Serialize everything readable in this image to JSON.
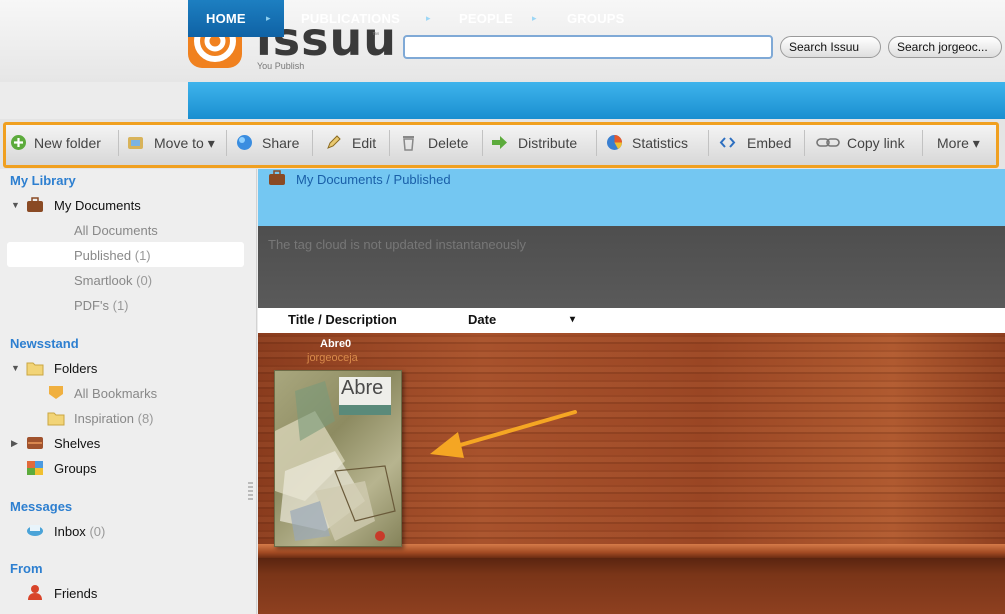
{
  "header": {
    "logo_text": "issuu",
    "logo_tm": "™",
    "tagline": "You Publish",
    "search_value": "",
    "search_issuu_label": "Search Issuu",
    "search_user_label": "Search jorgeoc..."
  },
  "nav": {
    "tabs": [
      {
        "label": "HOME",
        "active": true
      },
      {
        "label": "PUBLICATIONS",
        "active": false
      },
      {
        "label": "PEOPLE",
        "active": false
      },
      {
        "label": "GROUPS",
        "active": false
      }
    ],
    "arrow_glyph": "▸"
  },
  "toolbar": {
    "items": [
      {
        "label": "New folder",
        "icon": "new-folder-icon"
      },
      {
        "label": "Move to ▾",
        "icon": "move-to-icon"
      },
      {
        "label": "Share",
        "icon": "share-icon"
      },
      {
        "label": "Edit",
        "icon": "edit-icon"
      },
      {
        "label": "Delete",
        "icon": "delete-icon"
      },
      {
        "label": "Distribute",
        "icon": "distribute-icon"
      },
      {
        "label": "Statistics",
        "icon": "statistics-icon"
      },
      {
        "label": "Embed",
        "icon": "embed-icon"
      },
      {
        "label": "Copy link",
        "icon": "copy-link-icon"
      },
      {
        "label": "More ▾",
        "icon": ""
      }
    ],
    "highlight_color": "#f0a020"
  },
  "sidebar": {
    "library_title": "My Library",
    "my_documents": "My Documents",
    "all_documents": "All Documents",
    "published": "Published",
    "published_count": "(1)",
    "smartlook": "Smartlook",
    "smartlook_count": "(0)",
    "pdfs": "PDF's",
    "pdfs_count": "(1)",
    "newsstand_title": "Newsstand",
    "folders": "Folders",
    "all_bookmarks": "All Bookmarks",
    "inspiration": "Inspiration",
    "inspiration_count": "(8)",
    "shelves": "Shelves",
    "groups": "Groups",
    "messages_title": "Messages",
    "inbox": "Inbox",
    "inbox_count": "(0)",
    "from_title": "From",
    "friends": "Friends"
  },
  "content": {
    "breadcrumb": "My Documents / Published",
    "tag_cloud_note": "The tag cloud is not updated instantaneously",
    "col_title": "Title / Description",
    "col_date": "Date",
    "sort_glyph": "▾",
    "document": {
      "title": "Abre0",
      "author": "jorgeoceja",
      "cover_word": "Abre"
    },
    "arrow_color": "#f5a623"
  }
}
